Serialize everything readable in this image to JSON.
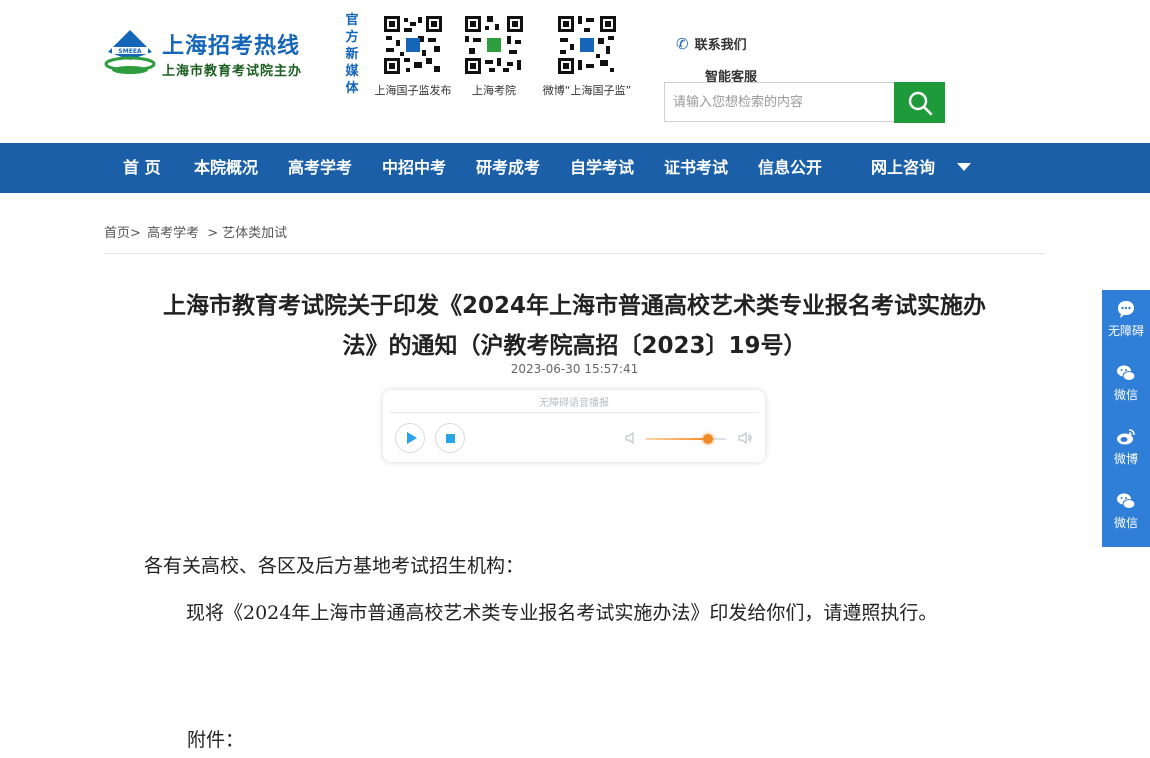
{
  "header": {
    "site_title": "上海招考热线",
    "site_subtitle": "上海市教育考试院主办",
    "logo_mark_text": "SMEEA",
    "media_label": "官方新媒体",
    "qr_codes": [
      {
        "caption": "上海国子监发布"
      },
      {
        "caption": "上海考院"
      },
      {
        "caption": "微博“上海国子监”"
      }
    ],
    "contact_label": "联系我们",
    "service_label": "智能客服",
    "search": {
      "placeholder": "请输入您想检索的内容"
    }
  },
  "nav": {
    "items": [
      "首 页",
      "本院概况",
      "高考学考",
      "中招中考",
      "研考成考",
      "自学考试",
      "证书考试",
      "信息公开",
      "网上咨询"
    ]
  },
  "breadcrumb": {
    "home": "首页",
    "sep": ">",
    "level1": "高考学考",
    "level2": "艺体类加试"
  },
  "article": {
    "title_line1": "上海市教育考试院关于印发《2024年上海市普通高校艺术类专业报名考试实施办",
    "title_line2": "法》的通知（沪教考院高招〔2023〕19号）",
    "date": "2023-06-30 15:57:41",
    "salutation": "各有关高校、各区及后方基地考试招生机构：",
    "body": "现将《2024年上海市普通高校艺术类专业报名考试实施办法》印发给你们，请遵照执行。",
    "attachment_label": "附件："
  },
  "player": {
    "label": "无障碍语音播报",
    "volume": 0.78
  },
  "sidebar": {
    "items": [
      {
        "label": "无障碍",
        "icon": "chat-bubble-icon"
      },
      {
        "label": "微信",
        "icon": "wechat-icon"
      },
      {
        "label": "微博",
        "icon": "weibo-icon"
      },
      {
        "label": "微信",
        "icon": "wechat-icon"
      }
    ]
  },
  "colors": {
    "brand_blue": "#1a5fa8",
    "search_green": "#1e9a3a",
    "sidebar_blue": "#2f7ed8",
    "player_accent": "#2aa3e8",
    "volume_orange": "#f08a24"
  }
}
